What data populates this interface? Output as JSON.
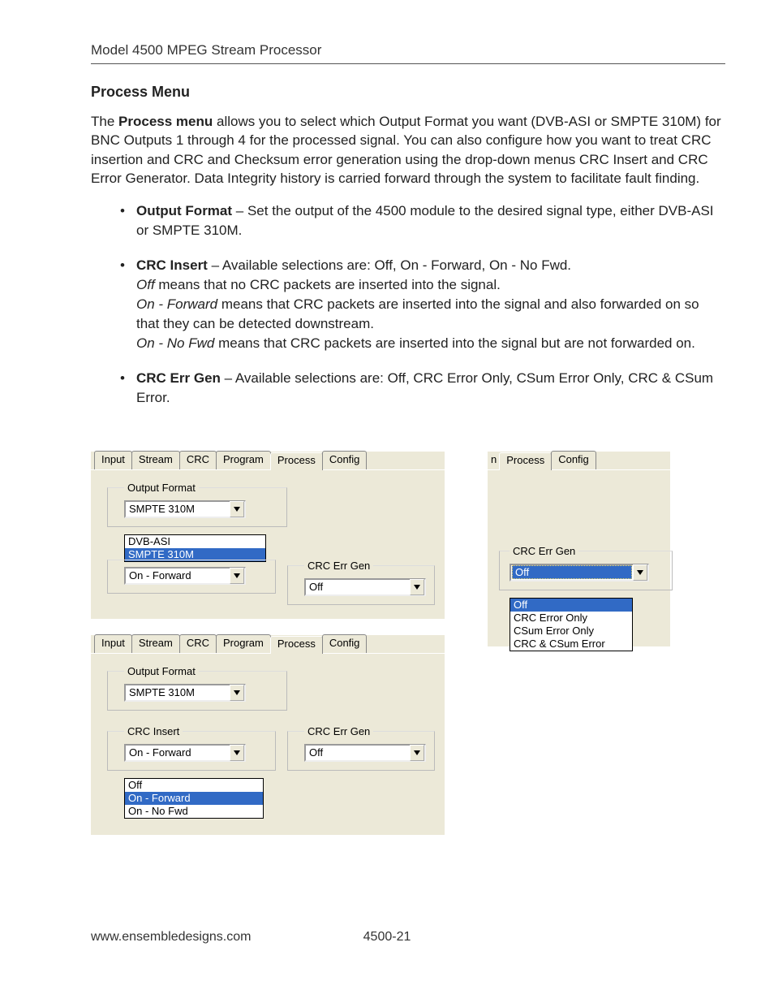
{
  "header": {
    "running_head": "Model 4500 MPEG Stream Processor"
  },
  "section": {
    "title": "Process Menu",
    "intro_a": "The ",
    "intro_b": "Process menu",
    "intro_c": " allows you to select which Output Format you want (DVB-ASI or SMPTE 310M) for BNC Outputs 1 through 4 for the processed signal. You can also configure how you want to treat CRC insertion and CRC and Checksum error generation using the drop-down menus CRC Insert and CRC Error Generator. Data Integrity history is carried forward through the system to facilitate fault finding."
  },
  "bullets": {
    "b1_strong": "Output Format",
    "b1_rest": " – Set the output of the 4500 module to the desired signal type, either DVB-ASI or SMPTE 310M.",
    "b2_strong": "CRC Insert",
    "b2_rest": " – Available selections are: Off, On - Forward, On - No Fwd.",
    "b2_l2_em": "Off",
    "b2_l2_rest": " means that no CRC packets are inserted into the signal.",
    "b2_l3_em": "On - Forward",
    "b2_l3_rest": " means that CRC packets are inserted into the signal and also forwarded on so that they can be detected downstream.",
    "b2_l4_em": "On - No Fwd",
    "b2_l4_rest": " means that CRC packets are inserted into the signal but are not forwarded on.",
    "b3_strong": "CRC Err Gen",
    "b3_rest": " – Available selections are: Off, CRC Error Only, CSum Error Only, CRC & CSum Error."
  },
  "ui": {
    "tabs": {
      "input": "Input",
      "stream": "Stream",
      "crc": "CRC",
      "program": "Program",
      "process": "Process",
      "config": "Config",
      "n": "n"
    },
    "group": {
      "output_format": "Output Format",
      "crc_insert": "CRC Insert",
      "crc_err_gen": "CRC Err Gen"
    },
    "values": {
      "smpte": "SMPTE 310M",
      "dvb": "DVB-ASI",
      "on_forward": "On - Forward",
      "on_no_fwd": "On - No Fwd",
      "off": "Off",
      "crc_error_only": "CRC Error Only",
      "csum_error_only": "CSum Error Only",
      "crc_csum_error": "CRC & CSum Error"
    }
  },
  "footer": {
    "url": "www.ensembledesigns.com",
    "page": "4500-21"
  }
}
